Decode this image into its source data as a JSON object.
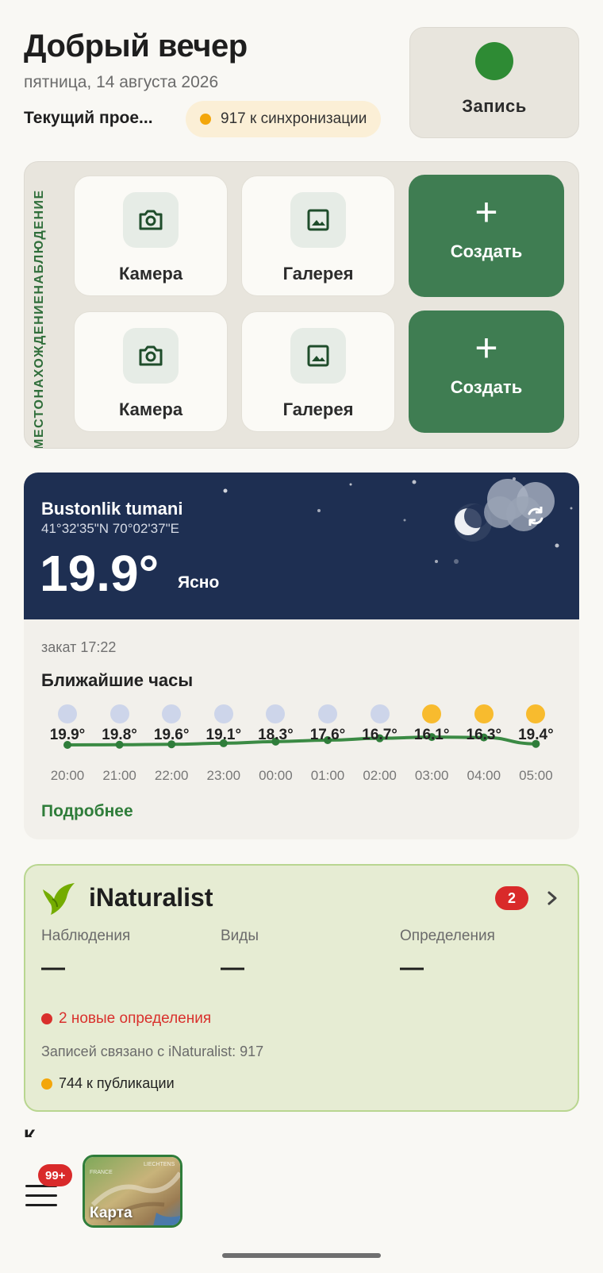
{
  "header": {
    "greeting": "Добрый вечер",
    "date": "пятница, 14 августа 2026",
    "project": "Текущий прое...",
    "sync_text": "917 к синхронизации",
    "record_label": "Запись"
  },
  "quick_actions": {
    "vertical_label": "МЕСТОНАХОЖДЕНИЕНАБЛЮДЕНИЕ",
    "camera": "Камера",
    "gallery": "Галерея",
    "create": "Создать",
    "plus": "+"
  },
  "weather": {
    "place": "Bustonlik tumani",
    "coords": "41°32'35\"N 70°02'37\"E",
    "temperature": "19.9°",
    "condition": "Ясно",
    "sunset": "закат 17:22",
    "hours_title": "Ближайшие часы",
    "more": "Подробнее",
    "hours": [
      {
        "time": "20:00",
        "temp": "19.9°",
        "value": 19.9,
        "symbol": "night"
      },
      {
        "time": "21:00",
        "temp": "19.8°",
        "value": 19.8,
        "symbol": "night"
      },
      {
        "time": "22:00",
        "temp": "19.6°",
        "value": 19.6,
        "symbol": "night"
      },
      {
        "time": "23:00",
        "temp": "19.1°",
        "value": 19.1,
        "symbol": "night"
      },
      {
        "time": "00:00",
        "temp": "18.3°",
        "value": 18.3,
        "symbol": "night"
      },
      {
        "time": "01:00",
        "temp": "17.6°",
        "value": 17.6,
        "symbol": "night"
      },
      {
        "time": "02:00",
        "temp": "16.7°",
        "value": 16.7,
        "symbol": "night"
      },
      {
        "time": "03:00",
        "temp": "16.1°",
        "value": 16.1,
        "symbol": "sun"
      },
      {
        "time": "04:00",
        "temp": "16.3°",
        "value": 16.3,
        "symbol": "sun"
      },
      {
        "time": "05:00",
        "temp": "19.4°",
        "value": 19.4,
        "symbol": "sun"
      }
    ]
  },
  "inaturalist": {
    "title": "iNaturalist",
    "badge": "2",
    "stats": [
      {
        "label": "Наблюдения",
        "value": "—"
      },
      {
        "label": "Виды",
        "value": "—"
      },
      {
        "label": "Определения",
        "value": "—"
      }
    ],
    "new_ids": "2 новые определения",
    "linked": "Записей связано с iNaturalist: 917",
    "to_publish": "744 к публикации"
  },
  "bottom": {
    "peek_text": "К",
    "menu_badge": "99+",
    "map_label": "Карта",
    "map_mini_1": "FRANCE",
    "map_mini_2": "LIECHTENS"
  },
  "colors": {
    "accent_green": "#3f7d52",
    "record_dot": "#2e8b34",
    "sky": "#1e2f52",
    "badge_red": "#d92a2a",
    "sync_orange": "#f3a60a"
  }
}
